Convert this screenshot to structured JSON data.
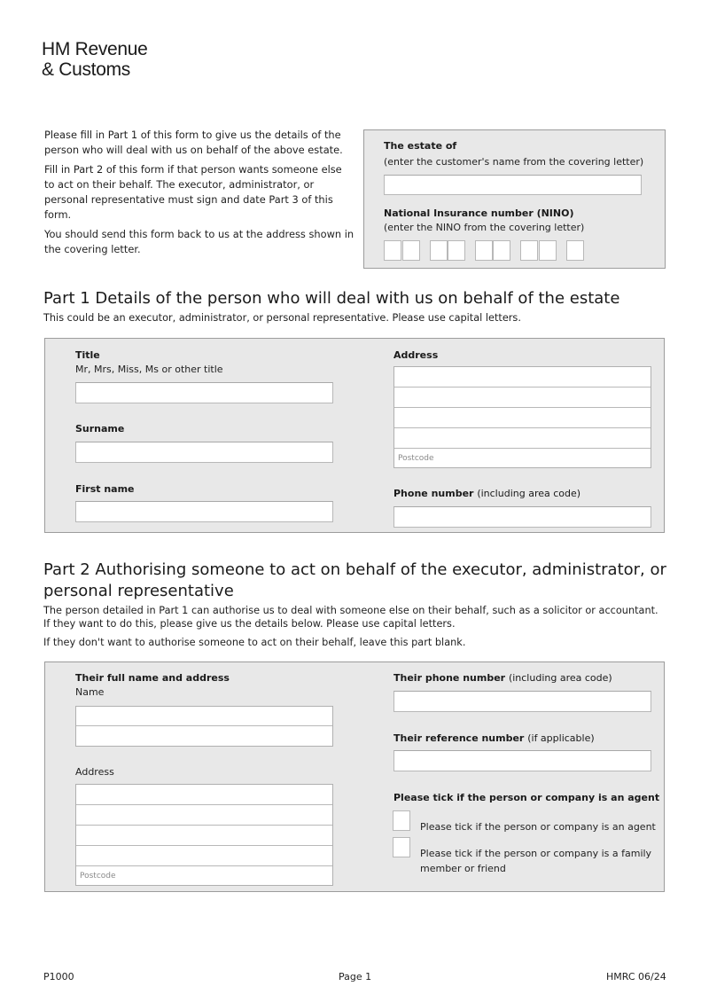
{
  "logo": {
    "line1": "HM Revenue",
    "line2": "& Customs"
  },
  "intro": {
    "paragraphs": [
      "Please fill in Part 1 of this form to give us the details of the person who will deal with us on behalf of the above estate.",
      "Fill in Part 2 of this form if that person wants someone else to act on their behalf. The executor, administrator, or personal representative must sign and date Part 3 of this form.",
      "You should send this form back to us at the address shown in the covering letter."
    ]
  },
  "estate_panel": {
    "estate_label": "The estate of",
    "estate_hint": "(enter the customer's name from the covering letter)",
    "estate_value": "",
    "nino_label": "National Insurance number (NINO)",
    "nino_hint": "(enter the NINO from the covering letter)",
    "nino_values": [
      "",
      "",
      "",
      "",
      "",
      "",
      "",
      "",
      ""
    ]
  },
  "part1": {
    "heading": "Part 1 Details of the person who will deal with us on behalf of the estate",
    "subtext": "This could be an executor, administrator, or personal representative. Please use capital letters.",
    "title_label": "Title",
    "title_hint": "Mr, Mrs, Miss, Ms or other title",
    "title_value": "",
    "surname_label": "Surname",
    "surname_value": "",
    "first_name_label": "First name",
    "first_name_value": "",
    "address_label": "Address",
    "address_lines": [
      "",
      "",
      "",
      ""
    ],
    "postcode_placeholder": "Postcode",
    "phone_label": "Phone number",
    "phone_hint": "(including area code)",
    "phone_value": ""
  },
  "part2": {
    "heading_line1": "Part 2 Authorising someone to act on behalf of the executor, administrator, or",
    "heading_line2": "personal representative",
    "para1_line1": "The person detailed in Part 1 can authorise us to deal with someone else on their behalf, such as a solicitor or accountant.",
    "para1_line2": "If they want to do this, please give us the details below. Please use capital letters.",
    "para2": "If they don't want to authorise someone to act on their behalf, leave this part blank.",
    "full_name_address_label": "Their full name and address",
    "name_label": "Name",
    "name_lines": [
      "",
      ""
    ],
    "address_label": "Address",
    "address_lines": [
      "",
      "",
      "",
      ""
    ],
    "postcode_placeholder": "Postcode",
    "phone_label": "Their phone number",
    "phone_hint": "(including area code)",
    "phone_value": "",
    "reference_label": "Their reference number",
    "reference_hint": "(if applicable)",
    "reference_value": "",
    "tick_heading": "Please tick if the person or company is an agent",
    "tick_options": [
      {
        "label": "Please tick if the person or company is an agent",
        "checked": false
      },
      {
        "label_line1": "Please tick if the person or company is a family",
        "label_line2": "member or friend",
        "checked": false
      }
    ]
  },
  "footer": {
    "form_code": "P1000",
    "page": "Page 1",
    "version": "HMRC 06/24"
  }
}
